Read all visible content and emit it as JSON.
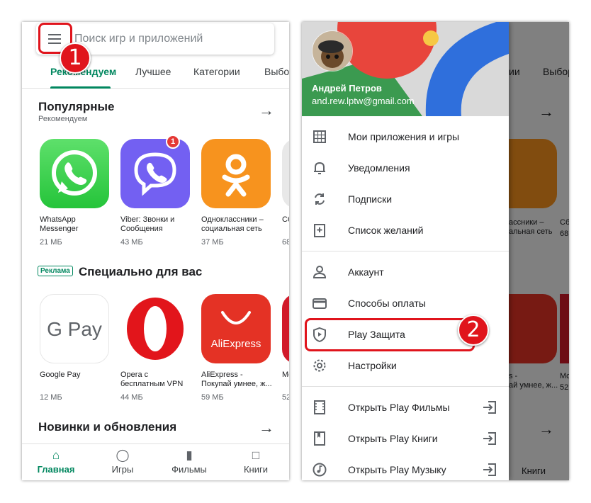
{
  "left": {
    "search_placeholder": "Поиск игр и приложений",
    "tabs": [
      "Рекомендуем",
      "Лучшее",
      "Категории",
      "Выбор"
    ],
    "sections": [
      {
        "title": "Популярные",
        "subtitle": "Рекомендуем"
      },
      {
        "title": "Специально для вас",
        "badge": "Реклама"
      },
      {
        "title": "Новинки и обновления"
      }
    ],
    "popular_apps": [
      {
        "name": "WhatsApp Messenger",
        "size": "21 МБ"
      },
      {
        "name": "Viber: Звонки и Сообщения",
        "size": "43 МБ",
        "badge": "1"
      },
      {
        "name": "Одноклассники – социальная сеть",
        "size": "37 МБ"
      },
      {
        "name": "Сб",
        "size": "68"
      }
    ],
    "special_apps": [
      {
        "name": "Google Pay",
        "size": "12 МБ",
        "logo": "G Pay"
      },
      {
        "name": "Opera с бесплатным VPN",
        "size": "44 МБ"
      },
      {
        "name": "AliExpress - Покупай умнее, ж...",
        "size": "59 МБ",
        "logo": "AliExpress"
      },
      {
        "name": "Mc",
        "size": "52"
      }
    ],
    "bottom_nav": [
      {
        "label": "Главная",
        "icon": "home-icon",
        "active": true
      },
      {
        "label": "Игры",
        "icon": "gamepad-icon"
      },
      {
        "label": "Фильмы",
        "icon": "film-icon"
      },
      {
        "label": "Книги",
        "icon": "bookmark-icon"
      }
    ]
  },
  "right": {
    "user_name": "Андрей Петров",
    "user_email": "and.rew.lptw@gmail.com",
    "menu_group1": [
      {
        "label": "Мои приложения и игры",
        "icon": "apps-grid-icon"
      },
      {
        "label": "Уведомления",
        "icon": "bell-icon"
      },
      {
        "label": "Подписки",
        "icon": "sync-icon"
      },
      {
        "label": "Список желаний",
        "icon": "wishlist-icon"
      }
    ],
    "menu_group2": [
      {
        "label": "Аккаунт",
        "icon": "person-icon"
      },
      {
        "label": "Способы оплаты",
        "icon": "credit-card-icon"
      },
      {
        "label": "Play Защита",
        "icon": "play-protect-icon"
      },
      {
        "label": "Настройки",
        "icon": "gear-icon"
      }
    ],
    "menu_group3": [
      {
        "label": "Открыть Play Фильмы",
        "icon": "film-icon"
      },
      {
        "label": "Открыть Play Книги",
        "icon": "bookmark-icon"
      },
      {
        "label": "Открыть Play Музыку",
        "icon": "music-icon"
      }
    ],
    "background": {
      "tabs": [
        "ии",
        "Выбор"
      ],
      "app_captions": [
        "ассники –",
        "альная сеть",
        "Сб",
        "68"
      ],
      "app_captions2": [
        "s -",
        "ай умнее, ж...",
        "Mc",
        "52"
      ],
      "books_label": "Книги"
    }
  },
  "steps": [
    "1",
    "2"
  ],
  "colors": {
    "accent_green": "#01875f",
    "highlight_red": "#e0141c"
  }
}
